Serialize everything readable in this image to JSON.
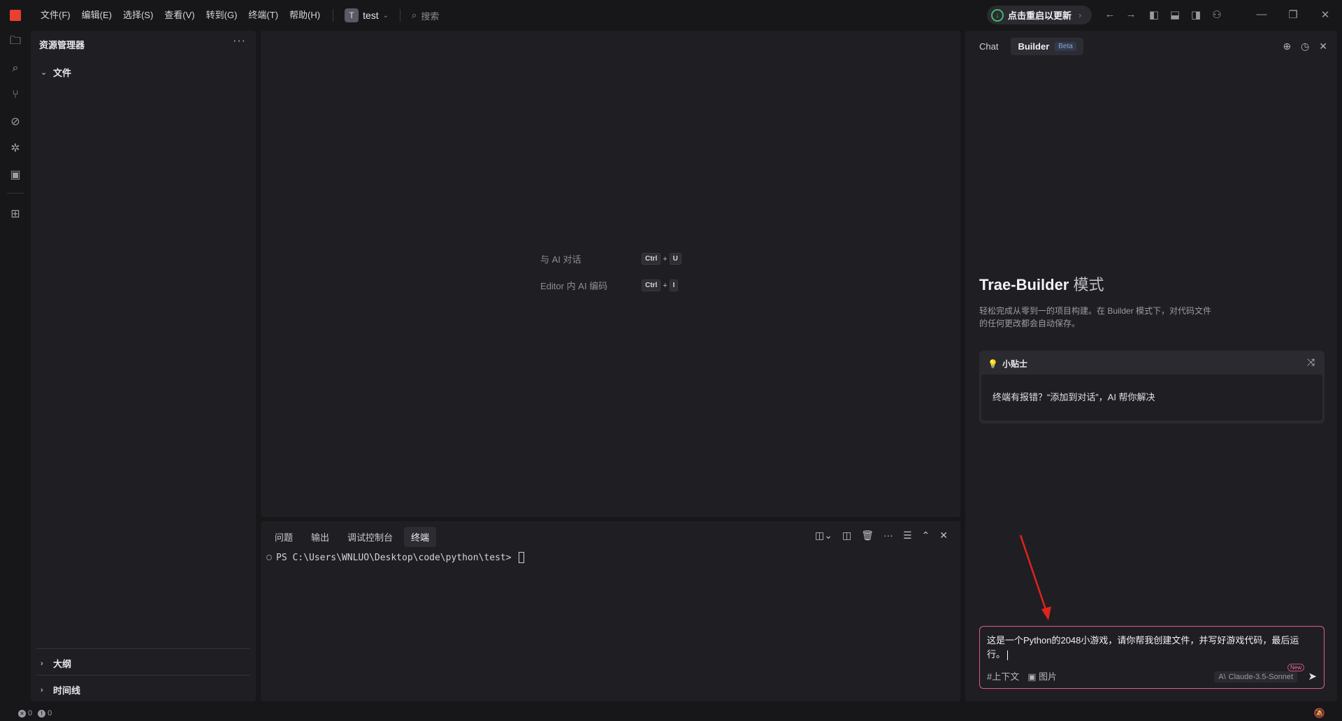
{
  "titlebar": {
    "menu": [
      "文件(F)",
      "编辑(E)",
      "选择(S)",
      "查看(V)",
      "转到(G)",
      "终端(T)",
      "帮助(H)"
    ],
    "project_initial": "T",
    "project_name": "test",
    "search_placeholder": "搜索",
    "update_label": "点击重启以更新"
  },
  "sidebar": {
    "title": "资源管理器",
    "files_label": "文件",
    "outline_label": "大纲",
    "timeline_label": "时间线"
  },
  "editor": {
    "shortcuts": [
      {
        "label": "与 AI 对话",
        "key1": "Ctrl",
        "key2": "U"
      },
      {
        "label": "Editor 内 AI 编码",
        "key1": "Ctrl",
        "key2": "I"
      }
    ]
  },
  "terminal": {
    "tabs": [
      "问题",
      "输出",
      "调试控制台",
      "终端"
    ],
    "active_tab": "终端",
    "prompt": "PS C:\\Users\\WNLUO\\Desktop\\code\\python\\test>"
  },
  "ai_panel": {
    "tab_chat": "Chat",
    "tab_builder": "Builder",
    "beta_badge": "Beta",
    "heading": "Trae-Builder",
    "heading_mode": "模式",
    "description": "轻松完成从零到一的项目构建。在 Builder 模式下，对代码文件的任何更改都会自动保存。",
    "tip_title": "小贴士",
    "tip_body": "终端有报错？“添加到对话”，AI 帮你解决",
    "input_text": "这是一个Python的2048小游戏，请你帮我创建文件，并写好游戏代码，最后运行。",
    "context_label": "#上下文",
    "image_label": "图片",
    "model_label": "Claude-3.5-Sonnet",
    "new_badge": "New"
  },
  "statusbar": {
    "errors": "0",
    "warnings": "0"
  },
  "colors": {
    "background": "#17171a",
    "panel": "#1f1f23",
    "accent_update": "#3fb96b",
    "input_border": "#e05a8a",
    "annotation_arrow": "#e0231c"
  }
}
